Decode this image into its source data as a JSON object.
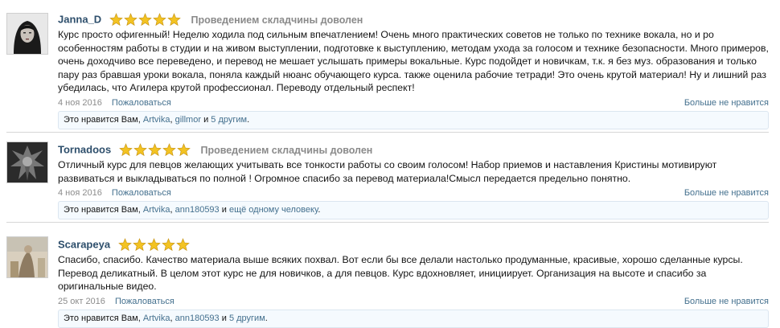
{
  "colors": {
    "author": "#2e4f6c",
    "link": "#44708e",
    "star": "#f3c322",
    "likes_bg": "#f5fafe"
  },
  "reviews": [
    {
      "author": "Janna_D",
      "rating": 5,
      "verdict": "Проведением складчины доволен",
      "text": "Курс просто офигенный! Неделю ходила под сильным впечатлением! Очень много практических советов не только по технике вокала, но и ро особенностям работы в студии и на живом выступлении, подготовке к выступлению, методам ухода за голосом и технике безопасности. Много примеров, очень доходчиво все переведено, и перевод не мешает услышать примеры вокальные. Курс подойдет и новичкам, т.к. я без муз. образования и только пару раз бравшая уроки вокала, поняла каждый нюанс обучающего курса. также оценила рабочие тетради! Это очень крутой материал! Ну и лишний раз убедилась, что Агилера крутой профессионал. Переводу отдельный респект!",
      "date": "4 ноя 2016",
      "report": "Пожаловаться",
      "unlike": "Больше не нравится",
      "likes": {
        "prefix": "Это нравится Вам,",
        "user1": "Artvika",
        "sep": ",",
        "user2": "gillmor",
        "and": "и",
        "others": "5 другим",
        "end": "."
      }
    },
    {
      "author": "Tornadoos",
      "rating": 5,
      "verdict": "Проведением складчины доволен",
      "text": "Отличный курс для певцов желающих учитывать все тонкости работы со своим голосом! Набор приемов и наставления Кристины мотивируют развиваться и выкладываться по полной ! Огромное спасибо за перевод материала!Смысл передается предельно понятно.",
      "date": "4 ноя 2016",
      "report": "Пожаловаться",
      "unlike": "Больше не нравится",
      "likes": {
        "prefix": "Это нравится Вам,",
        "user1": "Artvika",
        "sep": ",",
        "user2": "ann180593",
        "and": "и",
        "others": "ещё одному человеку",
        "end": "."
      }
    },
    {
      "author": "Scarapeya",
      "rating": 5,
      "verdict": "",
      "text": "Спасибо, спасибо. Качество материала выше всяких похвал. Вот если бы все делали настолько продуманные, красивые, хорошо сделанные курсы. Перевод деликатный. В целом этот курс не для новичков, а для певцов. Курс вдохновляет, инициирует. Организация на высоте и спасибо за оригинальные видео.",
      "date": "25 окт 2016",
      "report": "Пожаловаться",
      "unlike": "Больше не нравится",
      "likes": {
        "prefix": "Это нравится Вам,",
        "user1": "Artvika",
        "sep": ",",
        "user2": "ann180593",
        "and": "и",
        "others": "5 другим",
        "end": "."
      }
    }
  ]
}
